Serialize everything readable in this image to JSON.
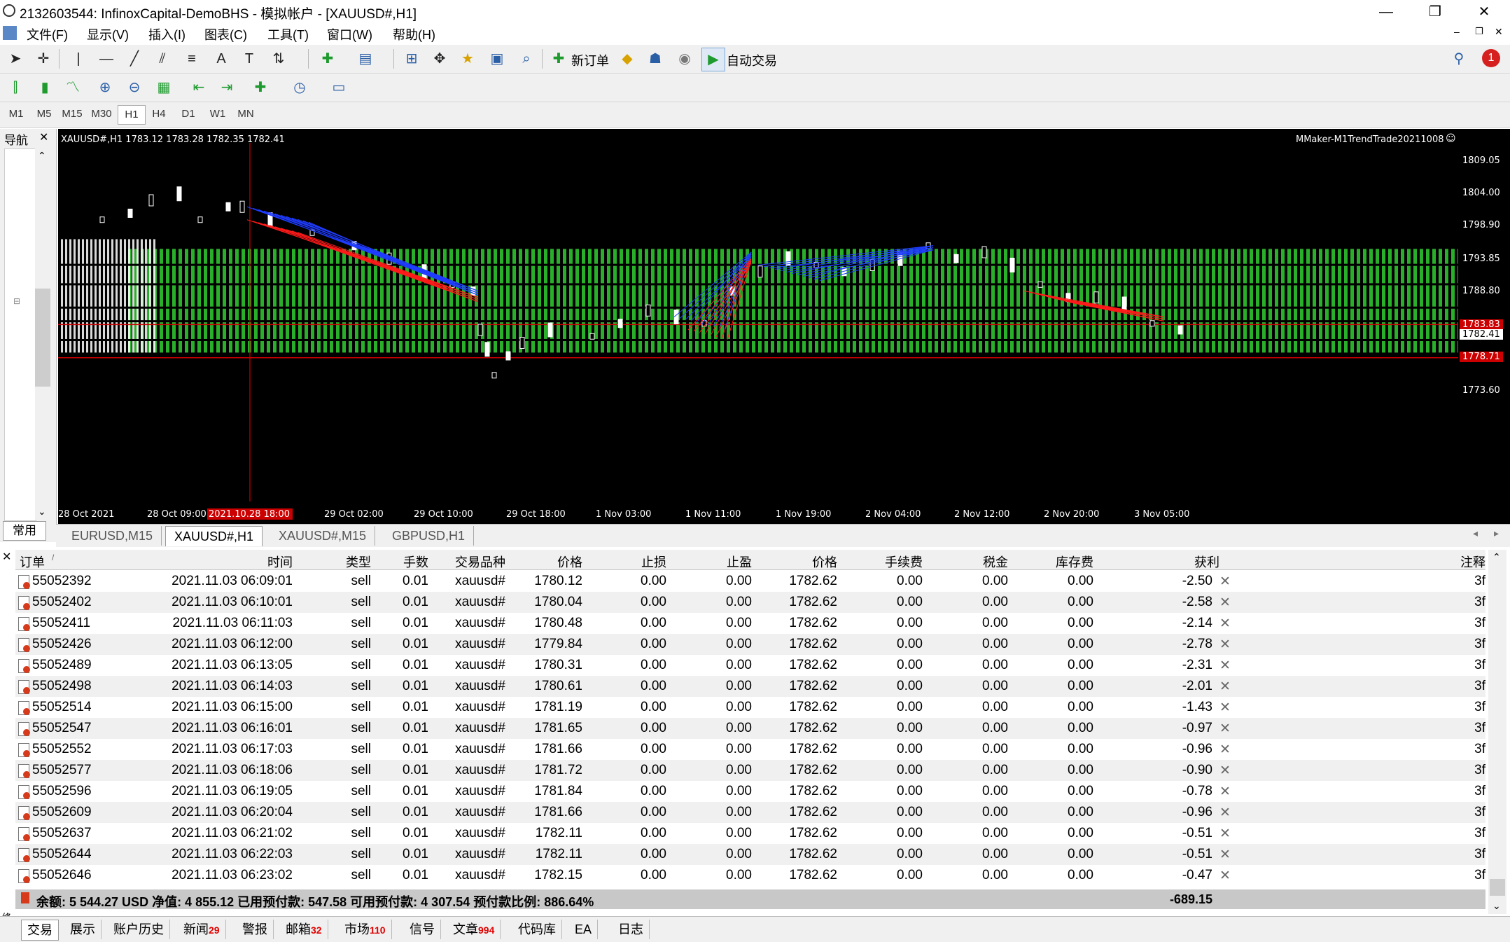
{
  "window": {
    "title": "2132603544: InfinoxCapital-DemoBHS - 模拟帐户 - [XAUUSD#,H1]",
    "min_glyph": "—",
    "restore_glyph": "❐",
    "close_glyph": "✕"
  },
  "menu": [
    "文件(F)",
    "显示(V)",
    "插入(I)",
    "图表(C)",
    "工具(T)",
    "窗口(W)",
    "帮助(H)"
  ],
  "toolbar": {
    "new_order": "新订单",
    "auto_trade": "自动交易",
    "notification_count": "1"
  },
  "timeframes": [
    "M1",
    "M5",
    "M15",
    "M30",
    "H1",
    "H4",
    "D1",
    "W1",
    "MN"
  ],
  "active_timeframe": "H1",
  "navigator": {
    "title": "导航",
    "tab": "常用"
  },
  "chart": {
    "symbol_info": "XAUUSD#,H1  1783.12 1783.28 1782.35 1782.41",
    "indicator": "MMaker-M1TrendTrade20211008",
    "price_labels": [
      "1809.05",
      "1804.00",
      "1798.90",
      "1793.85",
      "1788.80",
      "1783.83",
      "1782.41",
      "1778.71",
      "1773.60"
    ],
    "time_labels": [
      "28 Oct 2021",
      "28 Oct 09:00",
      "2021.10.28 18:00",
      "29 Oct 02:00",
      "29 Oct 10:00",
      "29 Oct 18:00",
      "1 Nov 03:00",
      "1 Nov 11:00",
      "1 Nov 19:00",
      "2 Nov 04:00",
      "2 Nov 12:00",
      "2 Nov 20:00",
      "3 Nov 05:00"
    ],
    "colors": {
      "background": "#000000",
      "grid_bar": "#2fc22f",
      "bid_line": "#cc0000",
      "blue_line": "#1f3cff",
      "red_line": "#ff1a1a"
    }
  },
  "chart_tabs": [
    "EURUSD,M15",
    "XAUUSD#,H1",
    "XAUUSD#,M15",
    "GBPUSD,H1"
  ],
  "active_chart_tab": "XAUUSD#,H1",
  "terminal": {
    "headers": [
      "订单",
      "时间",
      "类型",
      "手数",
      "交易品种",
      "价格",
      "止损",
      "止盈",
      "价格",
      "手续费",
      "税金",
      "库存费",
      "获利",
      "注释"
    ],
    "sort_marker": "/",
    "rows": [
      {
        "order": "55052392",
        "time": "2021.11.03 06:09:01",
        "type": "sell",
        "lots": "0.01",
        "symbol": "xauusd#",
        "open_price": "1780.12",
        "sl": "0.00",
        "tp": "0.00",
        "price": "1782.62",
        "commission": "0.00",
        "tax": "0.00",
        "swap": "0.00",
        "profit": "-2.50",
        "comment": "3f"
      },
      {
        "order": "55052402",
        "time": "2021.11.03 06:10:01",
        "type": "sell",
        "lots": "0.01",
        "symbol": "xauusd#",
        "open_price": "1780.04",
        "sl": "0.00",
        "tp": "0.00",
        "price": "1782.62",
        "commission": "0.00",
        "tax": "0.00",
        "swap": "0.00",
        "profit": "-2.58",
        "comment": "3f"
      },
      {
        "order": "55052411",
        "time": "2021.11.03 06:11:03",
        "type": "sell",
        "lots": "0.01",
        "symbol": "xauusd#",
        "open_price": "1780.48",
        "sl": "0.00",
        "tp": "0.00",
        "price": "1782.62",
        "commission": "0.00",
        "tax": "0.00",
        "swap": "0.00",
        "profit": "-2.14",
        "comment": "3f"
      },
      {
        "order": "55052426",
        "time": "2021.11.03 06:12:00",
        "type": "sell",
        "lots": "0.01",
        "symbol": "xauusd#",
        "open_price": "1779.84",
        "sl": "0.00",
        "tp": "0.00",
        "price": "1782.62",
        "commission": "0.00",
        "tax": "0.00",
        "swap": "0.00",
        "profit": "-2.78",
        "comment": "3f"
      },
      {
        "order": "55052489",
        "time": "2021.11.03 06:13:05",
        "type": "sell",
        "lots": "0.01",
        "symbol": "xauusd#",
        "open_price": "1780.31",
        "sl": "0.00",
        "tp": "0.00",
        "price": "1782.62",
        "commission": "0.00",
        "tax": "0.00",
        "swap": "0.00",
        "profit": "-2.31",
        "comment": "3f"
      },
      {
        "order": "55052498",
        "time": "2021.11.03 06:14:03",
        "type": "sell",
        "lots": "0.01",
        "symbol": "xauusd#",
        "open_price": "1780.61",
        "sl": "0.00",
        "tp": "0.00",
        "price": "1782.62",
        "commission": "0.00",
        "tax": "0.00",
        "swap": "0.00",
        "profit": "-2.01",
        "comment": "3f"
      },
      {
        "order": "55052514",
        "time": "2021.11.03 06:15:00",
        "type": "sell",
        "lots": "0.01",
        "symbol": "xauusd#",
        "open_price": "1781.19",
        "sl": "0.00",
        "tp": "0.00",
        "price": "1782.62",
        "commission": "0.00",
        "tax": "0.00",
        "swap": "0.00",
        "profit": "-1.43",
        "comment": "3f"
      },
      {
        "order": "55052547",
        "time": "2021.11.03 06:16:01",
        "type": "sell",
        "lots": "0.01",
        "symbol": "xauusd#",
        "open_price": "1781.65",
        "sl": "0.00",
        "tp": "0.00",
        "price": "1782.62",
        "commission": "0.00",
        "tax": "0.00",
        "swap": "0.00",
        "profit": "-0.97",
        "comment": "3f"
      },
      {
        "order": "55052552",
        "time": "2021.11.03 06:17:03",
        "type": "sell",
        "lots": "0.01",
        "symbol": "xauusd#",
        "open_price": "1781.66",
        "sl": "0.00",
        "tp": "0.00",
        "price": "1782.62",
        "commission": "0.00",
        "tax": "0.00",
        "swap": "0.00",
        "profit": "-0.96",
        "comment": "3f"
      },
      {
        "order": "55052577",
        "time": "2021.11.03 06:18:06",
        "type": "sell",
        "lots": "0.01",
        "symbol": "xauusd#",
        "open_price": "1781.72",
        "sl": "0.00",
        "tp": "0.00",
        "price": "1782.62",
        "commission": "0.00",
        "tax": "0.00",
        "swap": "0.00",
        "profit": "-0.90",
        "comment": "3f"
      },
      {
        "order": "55052596",
        "time": "2021.11.03 06:19:05",
        "type": "sell",
        "lots": "0.01",
        "symbol": "xauusd#",
        "open_price": "1781.84",
        "sl": "0.00",
        "tp": "0.00",
        "price": "1782.62",
        "commission": "0.00",
        "tax": "0.00",
        "swap": "0.00",
        "profit": "-0.78",
        "comment": "3f"
      },
      {
        "order": "55052609",
        "time": "2021.11.03 06:20:04",
        "type": "sell",
        "lots": "0.01",
        "symbol": "xauusd#",
        "open_price": "1781.66",
        "sl": "0.00",
        "tp": "0.00",
        "price": "1782.62",
        "commission": "0.00",
        "tax": "0.00",
        "swap": "0.00",
        "profit": "-0.96",
        "comment": "3f"
      },
      {
        "order": "55052637",
        "time": "2021.11.03 06:21:02",
        "type": "sell",
        "lots": "0.01",
        "symbol": "xauusd#",
        "open_price": "1782.11",
        "sl": "0.00",
        "tp": "0.00",
        "price": "1782.62",
        "commission": "0.00",
        "tax": "0.00",
        "swap": "0.00",
        "profit": "-0.51",
        "comment": "3f"
      },
      {
        "order": "55052644",
        "time": "2021.11.03 06:22:03",
        "type": "sell",
        "lots": "0.01",
        "symbol": "xauusd#",
        "open_price": "1782.11",
        "sl": "0.00",
        "tp": "0.00",
        "price": "1782.62",
        "commission": "0.00",
        "tax": "0.00",
        "swap": "0.00",
        "profit": "-0.51",
        "comment": "3f"
      },
      {
        "order": "55052646",
        "time": "2021.11.03 06:23:02",
        "type": "sell",
        "lots": "0.01",
        "symbol": "xauusd#",
        "open_price": "1782.15",
        "sl": "0.00",
        "tp": "0.00",
        "price": "1782.62",
        "commission": "0.00",
        "tax": "0.00",
        "swap": "0.00",
        "profit": "-0.47",
        "comment": "3f"
      }
    ],
    "summary": "余额: 5 544.27 USD  净值: 4 855.12  已用预付款: 547.58  可用预付款: 4 307.54  预付款比例: 886.64%",
    "total_profit": "-689.15"
  },
  "bottom_tabs": [
    {
      "label": "交易",
      "badge": ""
    },
    {
      "label": "展示",
      "badge": ""
    },
    {
      "label": "账户历史",
      "badge": ""
    },
    {
      "label": "新闻",
      "badge": "29"
    },
    {
      "label": "警报",
      "badge": ""
    },
    {
      "label": "邮箱",
      "badge": "32"
    },
    {
      "label": "市场",
      "badge": "110"
    },
    {
      "label": "信号",
      "badge": ""
    },
    {
      "label": "文章",
      "badge": "994"
    },
    {
      "label": "代码库",
      "badge": ""
    },
    {
      "label": "EA",
      "badge": ""
    },
    {
      "label": "日志",
      "badge": ""
    }
  ],
  "side_label": "终端"
}
